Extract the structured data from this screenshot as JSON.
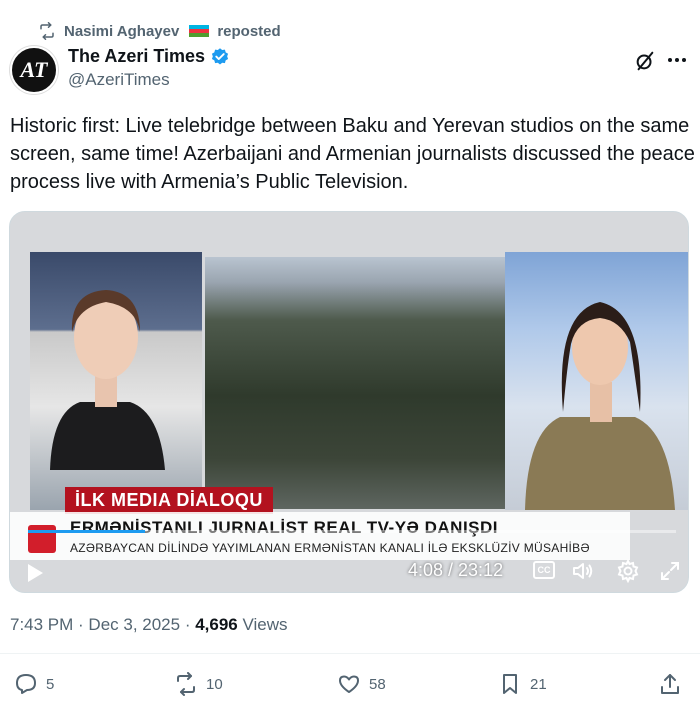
{
  "repost": {
    "reposter": "Nasimi Aghayev",
    "action": "reposted"
  },
  "author": {
    "display_name": "The Azeri Times",
    "handle": "@AzeriTimes",
    "avatar_text": "AT",
    "verified": true
  },
  "tweet": {
    "text": "Historic first: Live telebridge between Baku and Yerevan studios on the same screen, same time! Azerbaijani and Armenian journalists discussed the peace process live with Armenia’s Public Television."
  },
  "video": {
    "lower_third_label": "İLK MEDIA DİALOQU",
    "headline": "ERMƏNİSTANLI JURNALİST REAL TV-YƏ DANIŞDI",
    "subheadline": "AZƏRBAYCAN DİLİNDƏ YAYIMLANAN ERMƏNİSTAN KANALI İLƏ EKSKLÜZİV MÜSAHİBƏ",
    "time_display": "4:08 / 23:12",
    "progress": 0.18
  },
  "meta": {
    "time": "7:43 PM",
    "date": "Dec 3, 2025",
    "separator": " · ",
    "views_count": "4,696",
    "views_label": "Views"
  },
  "actions": {
    "replies": "5",
    "reposts": "10",
    "likes": "58",
    "bookmarks": "21"
  },
  "colors": {
    "text_primary": "#0f1419",
    "text_secondary": "#536471",
    "verified_blue": "#1d9bf0",
    "lower_third_red": "#b3121f"
  }
}
